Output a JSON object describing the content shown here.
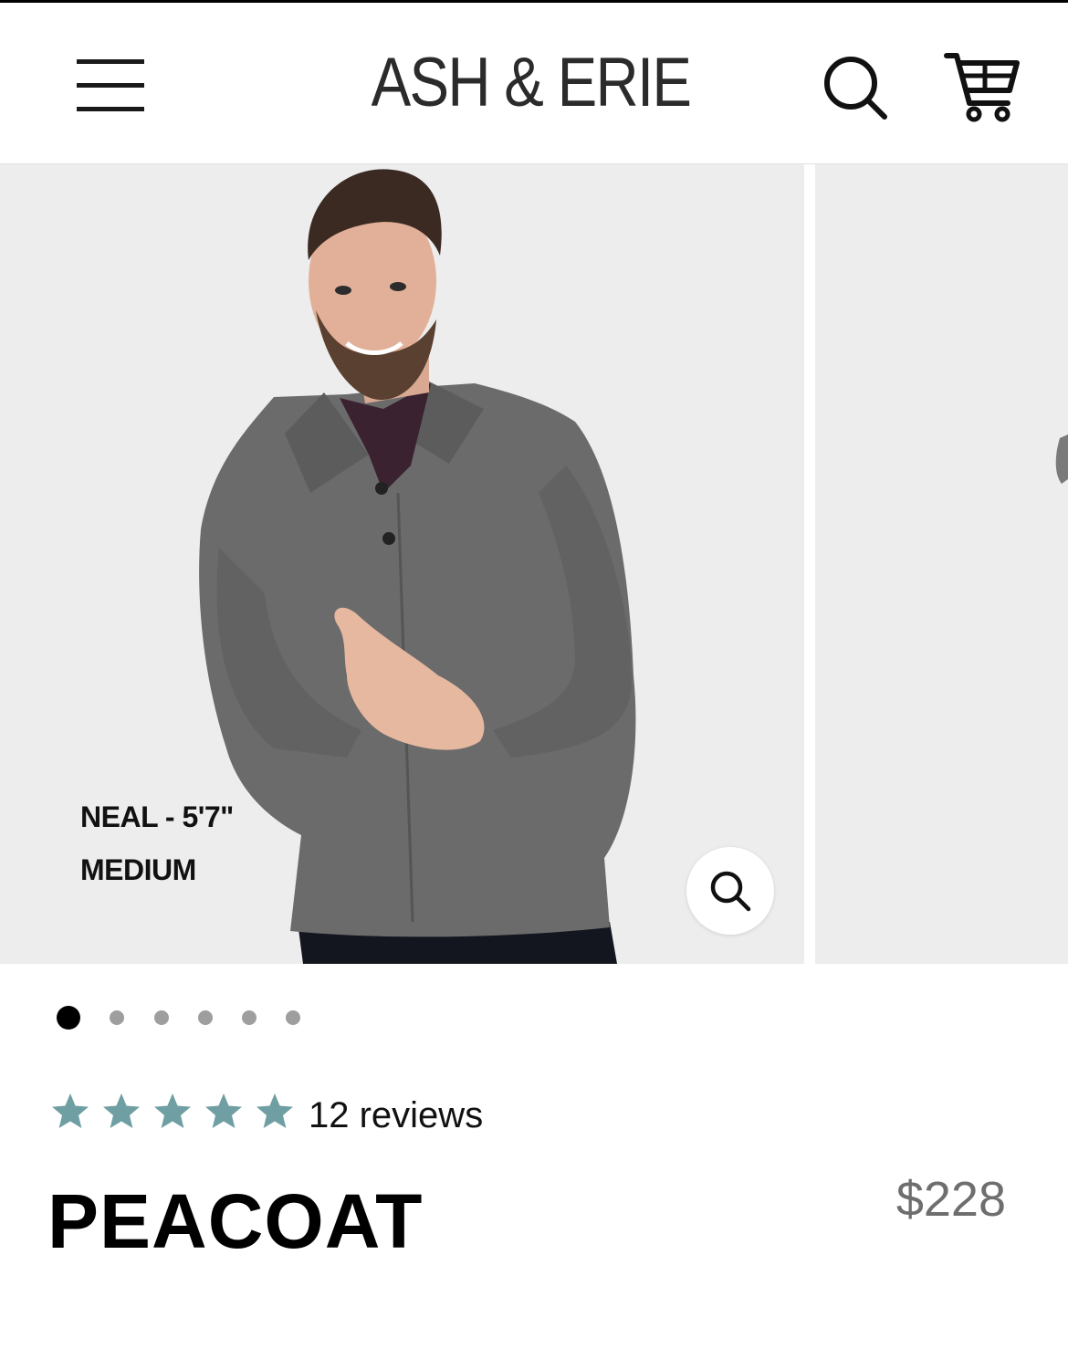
{
  "header": {
    "brand": "ASH & ERIE",
    "icons": {
      "menu": "hamburger-menu-icon",
      "search": "search-icon",
      "cart": "shopping-cart-icon"
    }
  },
  "gallery": {
    "model_caption_line1": "NEAL - 5'7\"",
    "model_caption_line2": "MEDIUM",
    "image_count": 6,
    "active_index": 0,
    "zoom_icon": "magnify-icon"
  },
  "product": {
    "rating": 5,
    "rating_max": 5,
    "reviews_label": "12 reviews",
    "name": "PEACOAT",
    "price": "$228"
  },
  "colors": {
    "star": "#6f9fa3",
    "image_bg": "#ededed",
    "coat": "#6a6a6a",
    "price": "#6e6e6e"
  }
}
